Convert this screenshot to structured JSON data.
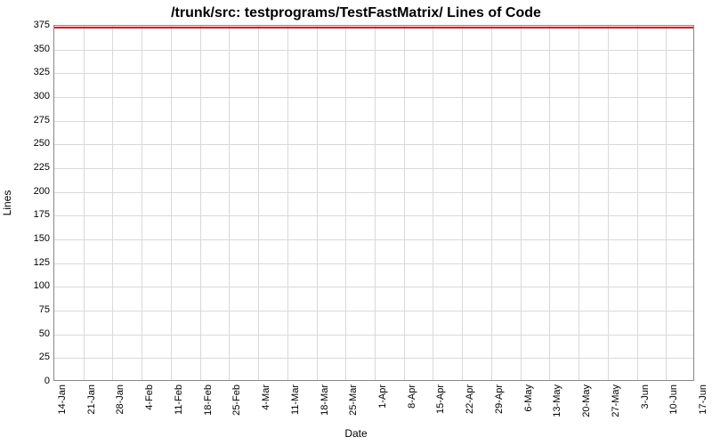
{
  "chart_data": {
    "type": "line",
    "title": "/trunk/src: testprograms/TestFastMatrix/ Lines of Code",
    "xlabel": "Date",
    "ylabel": "Lines",
    "ylim": [
      0,
      375
    ],
    "y_ticks": [
      0,
      25,
      50,
      75,
      100,
      125,
      150,
      175,
      200,
      225,
      250,
      275,
      300,
      325,
      350,
      375
    ],
    "categories": [
      "14-Jan",
      "21-Jan",
      "28-Jan",
      "4-Feb",
      "11-Feb",
      "18-Feb",
      "25-Feb",
      "4-Mar",
      "11-Mar",
      "18-Mar",
      "25-Mar",
      "1-Apr",
      "8-Apr",
      "15-Apr",
      "22-Apr",
      "29-Apr",
      "6-May",
      "13-May",
      "20-May",
      "27-May",
      "3-Jun",
      "10-Jun",
      "17-Jun"
    ],
    "series": [
      {
        "name": "Lines of Code",
        "color": "#e00000",
        "values": [
          374,
          374,
          374,
          374,
          374,
          374,
          374,
          374,
          374,
          374,
          374,
          374,
          374,
          374,
          374,
          374,
          374,
          374,
          374,
          374,
          374,
          374,
          374
        ]
      }
    ]
  }
}
